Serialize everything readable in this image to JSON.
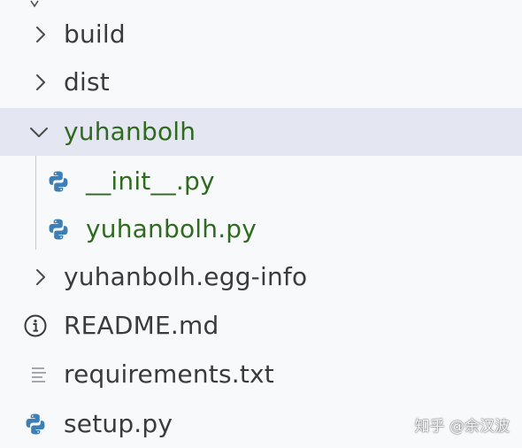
{
  "explorer": {
    "items": [
      {
        "label": "build",
        "type": "folder",
        "state": "collapsed",
        "icon": "chevron-right-icon"
      },
      {
        "label": "dist",
        "type": "folder",
        "state": "collapsed",
        "icon": "chevron-right-icon"
      },
      {
        "label": "yuhanbolh",
        "type": "folder",
        "state": "expanded",
        "selected": true,
        "icon": "chevron-down-icon"
      },
      {
        "label": "__init__.py",
        "type": "file",
        "icon": "python-icon",
        "indent": 1
      },
      {
        "label": "yuhanbolh.py",
        "type": "file",
        "icon": "python-icon",
        "indent": 1
      },
      {
        "label": "yuhanbolh.egg-info",
        "type": "folder",
        "state": "collapsed",
        "icon": "chevron-right-icon"
      },
      {
        "label": "README.md",
        "type": "file",
        "icon": "info-icon"
      },
      {
        "label": "requirements.txt",
        "type": "file",
        "icon": "text-lines-icon"
      },
      {
        "label": "setup.py",
        "type": "file",
        "icon": "python-icon"
      }
    ]
  },
  "watermark": "知乎 @余汉波",
  "colors": {
    "background": "#f8f9fb",
    "selected_row": "#e4e6f1",
    "modified_text": "#2f6b1f",
    "default_text": "#3b3b3b",
    "python_icon": "#3d7fb5"
  }
}
